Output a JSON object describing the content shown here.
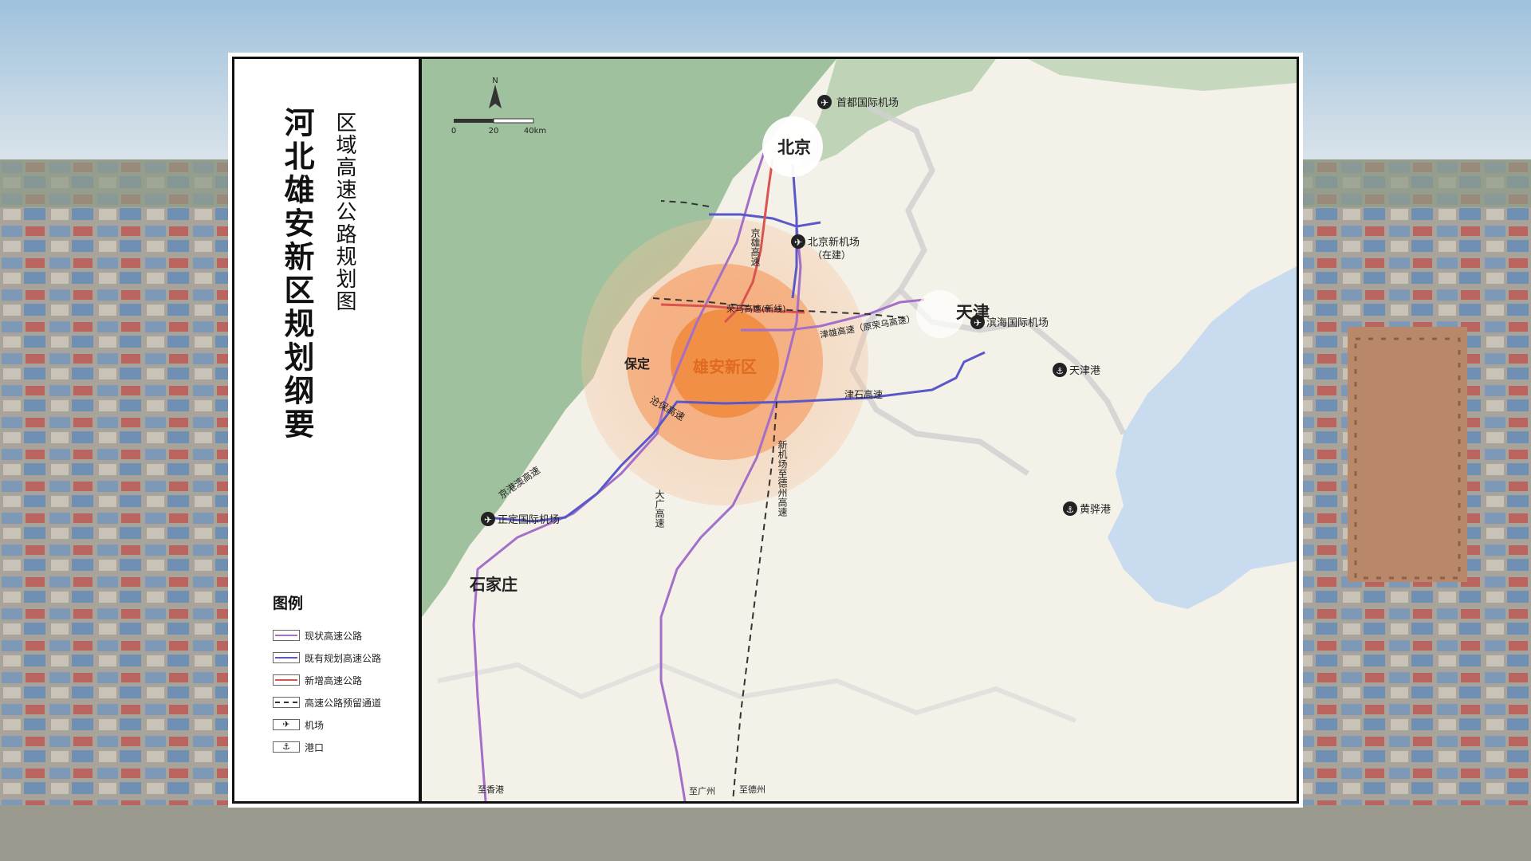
{
  "title": "河北雄安新区规划纲要",
  "subtitle": "区域高速公路规划图",
  "north_arrow_label": "N",
  "scale_bar": {
    "ticks": [
      "0",
      "20",
      "40km"
    ]
  },
  "legend": {
    "title": "图例",
    "items": [
      {
        "label": "现状高速公路",
        "icon": "line-existing",
        "color": "#a36fc9"
      },
      {
        "label": "既有规划高速公路",
        "icon": "line-planned",
        "color": "#5a58c8"
      },
      {
        "label": "新增高速公路",
        "icon": "line-new",
        "color": "#d9534f"
      },
      {
        "label": "高速公路预留通道",
        "icon": "line-reserved-dashed",
        "color": "#333333"
      },
      {
        "label": "机场",
        "icon": "airport-icon"
      },
      {
        "label": "港口",
        "icon": "port-icon"
      }
    ]
  },
  "colors": {
    "existing": "#a36fc9",
    "planned": "#5a58c8",
    "new": "#d9534f",
    "reserved": "#333333",
    "mountain": "#8fb98f",
    "plain": "#f3f1e8",
    "sea": "#c9dcef",
    "core": "#f08a3c"
  },
  "map": {
    "cities": {
      "beijing": "北京",
      "tianjin": "天津",
      "baoding": "保定",
      "shijiazhuang": "石家庄",
      "xiongan": "雄安新区"
    },
    "airports": {
      "capital": "首都国际机场",
      "daxing": "北京新机场",
      "daxing_note": "（在建）",
      "binhai": "滨海国际机场",
      "zhengding": "正定国际机场"
    },
    "ports": {
      "tianjin": "天津港",
      "huanghua": "黄骅港"
    },
    "roads": {
      "jingxiong": "京雄高速",
      "rongwu": "荣乌高速(新线)",
      "jinxiong": "津雄高速（原荣乌高速）",
      "jinshi": "津石高速",
      "cangbao": "沧保高速",
      "jinggangao": "京港澳高速",
      "daguang": "大广高速",
      "xjc": "新机场至德州高速"
    },
    "exits": {
      "hongkong": "至香港",
      "guangzhou": "至广州",
      "dezhou": "至德州"
    }
  }
}
